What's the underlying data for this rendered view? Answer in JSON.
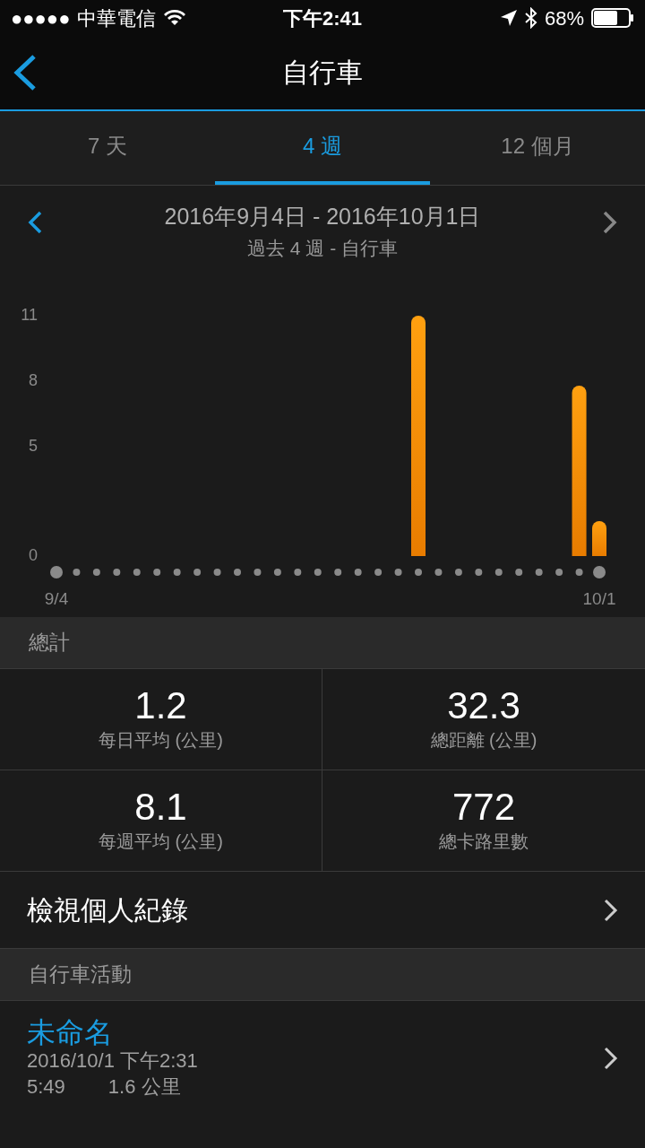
{
  "status_bar": {
    "signal_dots": "●●●●●",
    "carrier": "中華電信",
    "time": "下午2:41",
    "battery": "68%"
  },
  "nav": {
    "title": "自行車"
  },
  "tabs": [
    {
      "label": "7 天",
      "selected": false
    },
    {
      "label": "4 週",
      "selected": true
    },
    {
      "label": "12 個月",
      "selected": false
    }
  ],
  "period": {
    "range": "2016年9月4日 - 2016年10月1日",
    "subtitle": "過去 4 週 - 自行車"
  },
  "chart_data": {
    "type": "bar",
    "categories": [
      "9/4",
      null,
      null,
      null,
      null,
      null,
      null,
      null,
      null,
      null,
      null,
      null,
      null,
      null,
      null,
      null,
      null,
      null,
      null,
      null,
      null,
      null,
      null,
      null,
      null,
      null,
      null,
      "10/1"
    ],
    "values": [
      null,
      null,
      null,
      null,
      null,
      null,
      null,
      null,
      null,
      null,
      null,
      null,
      null,
      null,
      null,
      null,
      null,
      null,
      11,
      null,
      null,
      null,
      null,
      null,
      null,
      null,
      7.8,
      1.6
    ],
    "ylim": [
      0,
      11
    ],
    "yticks": [
      0,
      5,
      8,
      11
    ]
  },
  "totals": {
    "header": "總計",
    "stats": [
      {
        "value": "1.2",
        "label": "每日平均 (公里)"
      },
      {
        "value": "32.3",
        "label": "總距離 (公里)"
      },
      {
        "value": "8.1",
        "label": "每週平均 (公里)"
      },
      {
        "value": "772",
        "label": "總卡路里數"
      }
    ]
  },
  "records_link": "檢視個人紀錄",
  "activities": {
    "header": "自行車活動",
    "items": [
      {
        "title": "未命名",
        "datetime": "2016/10/1 下午2:31",
        "duration": "5:49",
        "distance": "1.6 公里"
      }
    ]
  }
}
